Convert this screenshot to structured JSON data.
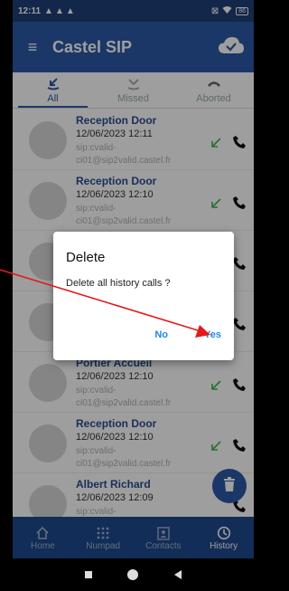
{
  "status": {
    "time": "12:11",
    "battery": "86"
  },
  "app": {
    "title": "Castel SIP"
  },
  "tabs": [
    {
      "label": "All",
      "icon": "incoming-call-icon",
      "active": true
    },
    {
      "label": "Missed",
      "icon": "missed-call-icon",
      "active": false
    },
    {
      "label": "Aborted",
      "icon": "hangup-icon",
      "active": false
    }
  ],
  "calls": [
    {
      "name": "Reception Door",
      "date": "12/06/2023 12:11",
      "sip1": "sip:cvalid-",
      "sip2": "ci01@sip2valid.castel.fr"
    },
    {
      "name": "Reception Door",
      "date": "12/06/2023 12:10",
      "sip1": "sip:cvalid-",
      "sip2": "ci01@sip2valid.castel.fr"
    },
    {
      "name": "",
      "date": "",
      "sip1": "",
      "sip2": ""
    },
    {
      "name": "",
      "date": "",
      "sip1": "",
      "sip2": ""
    },
    {
      "name": "Portier Accueil",
      "date": "12/06/2023 12:10",
      "sip1": "sip:cvalid-",
      "sip2": "ci01@sip2valid.castel.fr"
    },
    {
      "name": "Reception Door",
      "date": "12/06/2023 12:10",
      "sip1": "sip:cvalid-",
      "sip2": "ci01@sip2valid.castel.fr"
    },
    {
      "name": "Albert Richard",
      "date": "12/06/2023 12:09",
      "sip1": "sip:cvalid-",
      "sip2": ""
    }
  ],
  "dialog": {
    "title": "Delete",
    "message": "Delete all history calls ?",
    "no_label": "No",
    "yes_label": "Yes"
  },
  "nav": [
    {
      "label": "Home",
      "icon": "home-icon",
      "active": false
    },
    {
      "label": "Numpad",
      "icon": "numpad-icon",
      "active": false
    },
    {
      "label": "Contacts",
      "icon": "contacts-icon",
      "active": false
    },
    {
      "label": "History",
      "icon": "clock-icon",
      "active": true
    }
  ],
  "colors": {
    "primary": "#2a5aa6",
    "dialog_button": "#1e88e5",
    "incoming_arrow": "#3bb54a",
    "annotation": "#e21b1b"
  }
}
